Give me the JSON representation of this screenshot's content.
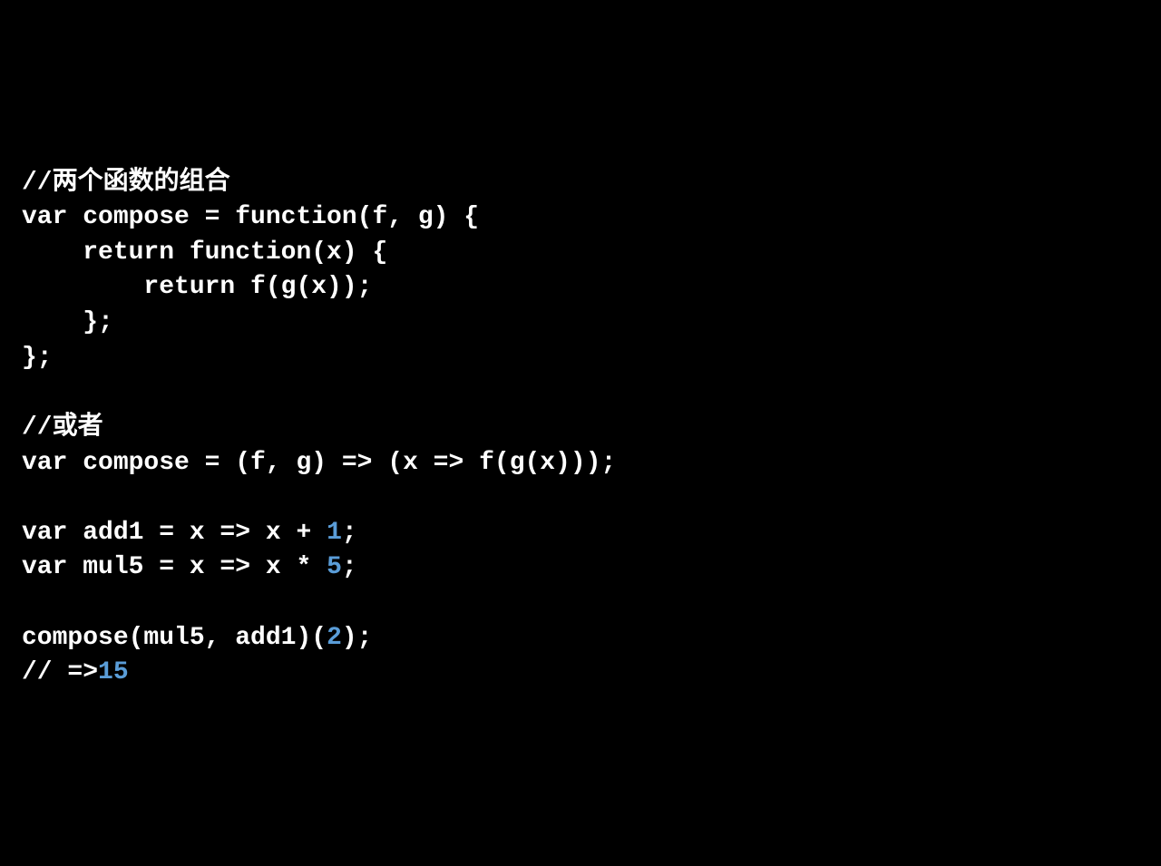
{
  "code": {
    "l1": "//两个函数的组合",
    "l2a": "var compose = function(f, g) {",
    "l3a": "    return function(x) {",
    "l4a": "        return f(g(x));",
    "l5a": "    };",
    "l6a": "};",
    "l7": "",
    "l8": "//或者",
    "l9": "var compose = (f, g) => (x => f(g(x)));",
    "l10": "",
    "l11a": "var add1 = x => x + ",
    "l11b": "1",
    "l11c": ";",
    "l12a": "var mul5 = x => x * ",
    "l12b": "5",
    "l12c": ";",
    "l13": "",
    "l14a": "compose(mul5, add1)(",
    "l14b": "2",
    "l14c": ");",
    "l15a": "// =>",
    "l15b": "15"
  }
}
